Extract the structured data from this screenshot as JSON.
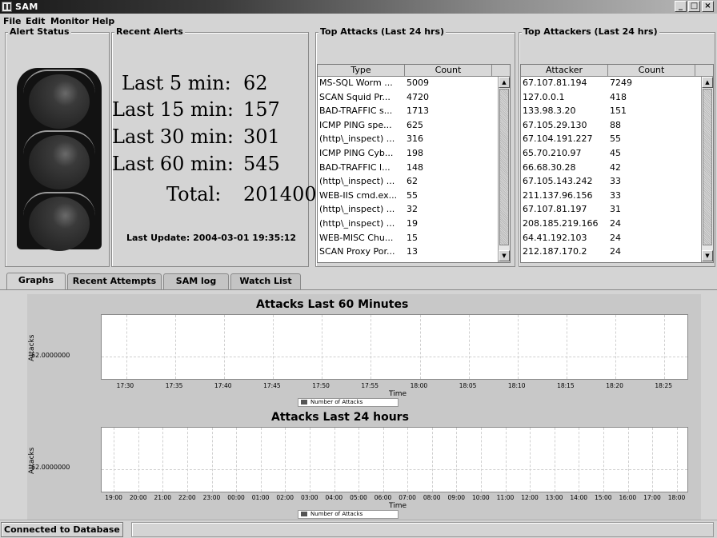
{
  "window": {
    "title": "SAM",
    "buttons": {
      "minimize": "_",
      "maximize": "□",
      "close": "×"
    }
  },
  "menu": {
    "file": "File",
    "edit": "Edit",
    "monitor": "Monitor",
    "help": "Help"
  },
  "alert_status": {
    "title": "Alert Status"
  },
  "recent_alerts": {
    "title": "Recent Alerts",
    "rows": [
      {
        "label": "Last 5 min:",
        "value": "62"
      },
      {
        "label": "Last 15 min:",
        "value": "157"
      },
      {
        "label": "Last 30 min:",
        "value": "301"
      },
      {
        "label": "Last 60 min:",
        "value": "545"
      },
      {
        "label": "Total:",
        "value": "201400"
      }
    ],
    "last_update": "Last Update: 2004-03-01 19:35:12"
  },
  "top_attacks": {
    "title": "Top Attacks  (Last 24 hrs)",
    "headers": [
      "Type",
      "Count"
    ],
    "rows": [
      [
        "MS-SQL Worm ...",
        "5009"
      ],
      [
        "SCAN Squid Pr...",
        "4720"
      ],
      [
        "BAD-TRAFFIC s...",
        "1713"
      ],
      [
        "ICMP PING spe...",
        "625"
      ],
      [
        "(http\\_inspect) ...",
        "316"
      ],
      [
        "ICMP PING Cyb...",
        "198"
      ],
      [
        "BAD-TRAFFIC l...",
        "148"
      ],
      [
        "(http\\_inspect) ...",
        "62"
      ],
      [
        "WEB-IIS cmd.ex...",
        "55"
      ],
      [
        "(http\\_inspect) ...",
        "32"
      ],
      [
        "(http\\_inspect) ...",
        "19"
      ],
      [
        "WEB-MISC Chu...",
        "15"
      ],
      [
        "SCAN Proxy Por...",
        "13"
      ]
    ]
  },
  "top_attackers": {
    "title": "Top Attackers  (Last 24 hrs)",
    "headers": [
      "Attacker",
      "Count"
    ],
    "rows": [
      [
        "67.107.81.194",
        "7249"
      ],
      [
        "127.0.0.1",
        "418"
      ],
      [
        "133.98.3.20",
        "151"
      ],
      [
        "67.105.29.130",
        "88"
      ],
      [
        "67.104.191.227",
        "55"
      ],
      [
        "65.70.210.97",
        "45"
      ],
      [
        "66.68.30.28",
        "42"
      ],
      [
        "67.105.143.242",
        "33"
      ],
      [
        "211.137.96.156",
        "33"
      ],
      [
        "67.107.81.197",
        "31"
      ],
      [
        "208.185.219.166",
        "24"
      ],
      [
        "64.41.192.103",
        "24"
      ],
      [
        "212.187.170.2",
        "24"
      ]
    ]
  },
  "tabs": [
    {
      "label": "Graphs",
      "active": true
    },
    {
      "label": "Recent Attempts",
      "active": false
    },
    {
      "label": "SAM log",
      "active": false
    },
    {
      "label": "Watch List",
      "active": false
    }
  ],
  "chart_data": [
    {
      "type": "line",
      "title": "Attacks Last 60 Minutes",
      "xlabel": "Time",
      "ylabel": "Attacks",
      "ytick": "62.0000000",
      "x": [
        "17:30",
        "17:35",
        "17:40",
        "17:45",
        "17:50",
        "17:55",
        "18:00",
        "18:05",
        "18:10",
        "18:15",
        "18:20",
        "18:25"
      ],
      "series": [
        {
          "name": "Number of Attacks",
          "values": []
        }
      ],
      "grid": true,
      "legend": "bottom"
    },
    {
      "type": "line",
      "title": "Attacks Last 24 hours",
      "xlabel": "Time",
      "ylabel": "Attacks",
      "ytick": "62.0000000",
      "x": [
        "19:00",
        "20:00",
        "21:00",
        "22:00",
        "23:00",
        "00:00",
        "01:00",
        "02:00",
        "03:00",
        "04:00",
        "05:00",
        "06:00",
        "07:00",
        "08:00",
        "09:00",
        "10:00",
        "11:00",
        "12:00",
        "13:00",
        "14:00",
        "15:00",
        "16:00",
        "17:00",
        "18:00"
      ],
      "series": [
        {
          "name": "Number of Attacks",
          "values": []
        }
      ],
      "grid": true,
      "legend": "bottom"
    }
  ],
  "status": {
    "text": "Connected to Database"
  }
}
